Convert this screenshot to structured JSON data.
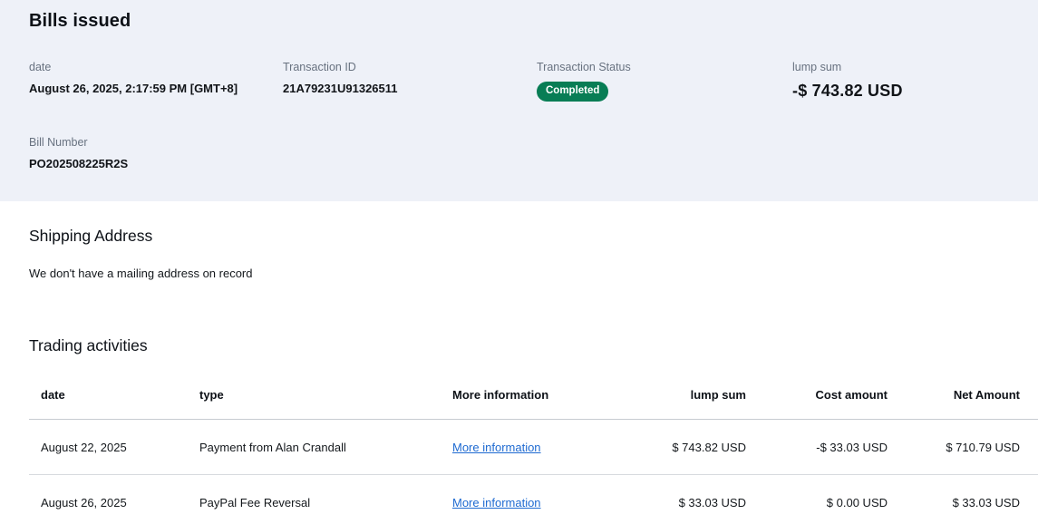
{
  "header": {
    "title": "Bills issued"
  },
  "summary": {
    "date": {
      "label": "date",
      "value": "August 26, 2025, 2:17:59 PM [GMT+8]"
    },
    "transaction_id": {
      "label": "Transaction ID",
      "value": "21A79231U91326511"
    },
    "status": {
      "label": "Transaction Status",
      "badge": "Completed",
      "badge_color": "#087d55"
    },
    "lump_sum": {
      "label": "lump sum",
      "value": "-$ 743.82 USD"
    },
    "bill_number": {
      "label": "Bill Number",
      "value": "PO202508225R2S"
    }
  },
  "shipping": {
    "title": "Shipping Address",
    "message": "We don't have a mailing address on record"
  },
  "trading": {
    "title": "Trading activities",
    "columns": [
      "date",
      "type",
      "More information",
      "lump sum",
      "Cost amount",
      "Net Amount"
    ],
    "rows": [
      {
        "date": "August 22, 2025",
        "type": "Payment from Alan Crandall",
        "more_info": "More information",
        "lump_sum": "$ 743.82 USD",
        "cost_amount": "-$ 33.03 USD",
        "net_amount": "$ 710.79 USD"
      },
      {
        "date": "August 26, 2025",
        "type": "PayPal Fee Reversal",
        "more_info": "More information",
        "lump_sum": "$ 33.03 USD",
        "cost_amount": "$ 0.00 USD",
        "net_amount": "$ 33.03 USD"
      }
    ]
  },
  "colors": {
    "section_tint": "#eef1f8",
    "badge_green": "#087d55",
    "link_blue": "#1e6ad1"
  }
}
